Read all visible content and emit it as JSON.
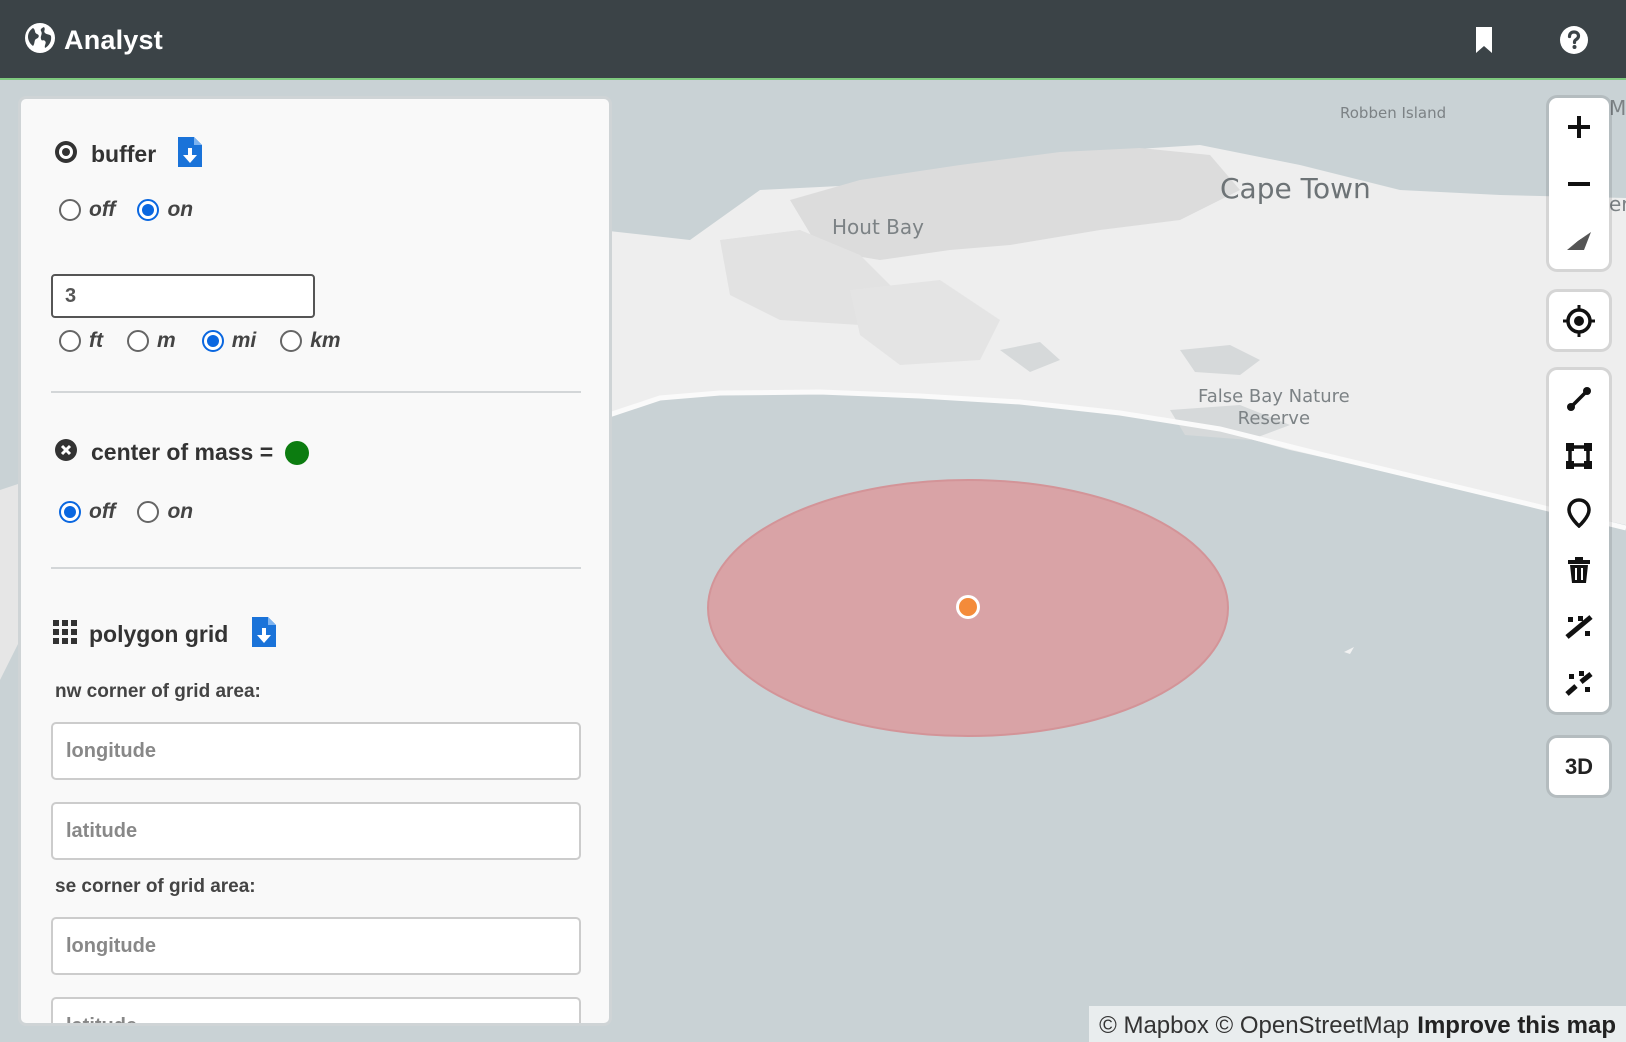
{
  "header": {
    "title": "Analyst",
    "bg_color": "#3b4347"
  },
  "map": {
    "labels": {
      "robben_island": "Robben Island",
      "cape_town": "Cape Town",
      "hout_bay": "Hout Bay",
      "false_bay_line1": "False Bay Nature",
      "false_bay_line2": "Reserve",
      "edge_top": "M",
      "edge_mid": "er"
    },
    "buffer_color": "#d9a3a6",
    "point_color": "#f48b3a",
    "attribution": {
      "text": "© Mapbox © OpenStreetMap",
      "link": "Improve this map"
    },
    "controls": {
      "zoom_in": "plus-icon",
      "zoom_out": "minus-icon",
      "compass": "compass-icon",
      "geolocate": "crosshair-icon",
      "draw_line": "line-icon",
      "draw_polygon": "polygon-icon",
      "draw_point": "marker-icon",
      "trash": "trash-icon",
      "combine": "combine-icon",
      "uncombine": "uncombine-icon",
      "three_d": "3D"
    }
  },
  "panel": {
    "buffer": {
      "title": "buffer",
      "toggle": [
        {
          "label": "off",
          "checked": false
        },
        {
          "label": "on",
          "checked": true
        }
      ],
      "value": "3",
      "units": [
        {
          "label": "ft",
          "checked": false
        },
        {
          "label": "m",
          "checked": false
        },
        {
          "label": "mi",
          "checked": true
        },
        {
          "label": "km",
          "checked": false
        }
      ]
    },
    "center_of_mass": {
      "title": "center of mass =",
      "swatch_color": "#0c7c10",
      "toggle": [
        {
          "label": "off",
          "checked": true
        },
        {
          "label": "on",
          "checked": false
        }
      ]
    },
    "polygon_grid": {
      "title": "polygon grid",
      "nw_label": "nw corner of grid area:",
      "se_label": "se corner of grid area:",
      "longitude_placeholder": "longitude",
      "latitude_placeholder": "latitude"
    }
  }
}
